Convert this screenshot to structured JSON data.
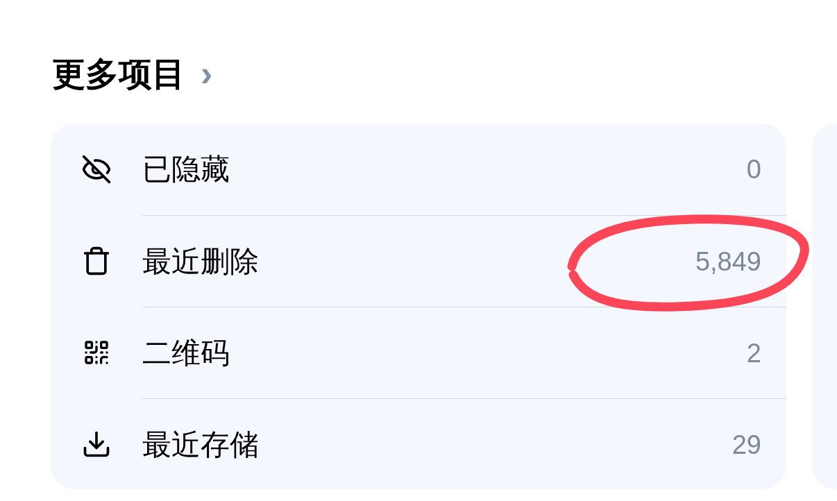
{
  "section": {
    "title": "更多项目",
    "chevron": "›"
  },
  "items": [
    {
      "label": "已隐藏",
      "count": "0"
    },
    {
      "label": "最近删除",
      "count": "5,849"
    },
    {
      "label": "二维码",
      "count": "2"
    },
    {
      "label": "最近存储",
      "count": "29"
    }
  ]
}
